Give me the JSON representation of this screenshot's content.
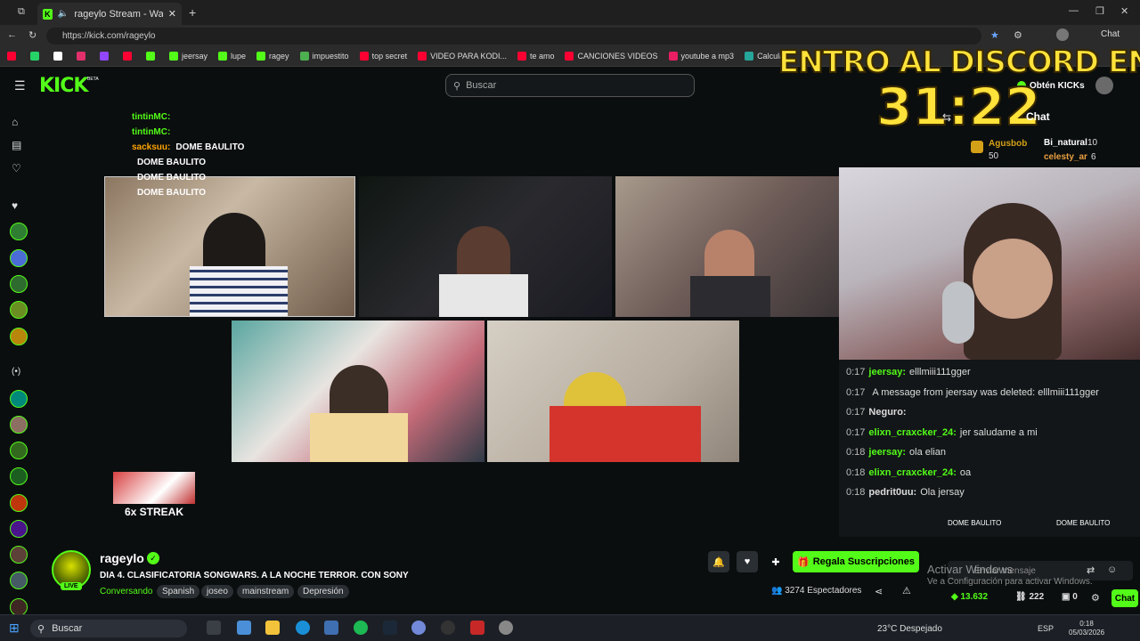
{
  "browser": {
    "tab_title": "rageylo Stream - Watch Live o",
    "url": "https://kick.com/rageylo",
    "profile_label": "Chat",
    "bookmarks": [
      {
        "label": "",
        "color": "#ff0033"
      },
      {
        "label": "",
        "color": "#25d366"
      },
      {
        "label": "",
        "color": "#ffffff"
      },
      {
        "label": "",
        "color": "#e1306c"
      },
      {
        "label": "",
        "color": "#9146ff"
      },
      {
        "label": "",
        "color": "#ff0033"
      },
      {
        "label": "",
        "color": "#53fc18"
      },
      {
        "label": "jeersay",
        "color": "#53fc18"
      },
      {
        "label": "lupe",
        "color": "#53fc18"
      },
      {
        "label": "ragey",
        "color": "#53fc18"
      },
      {
        "label": "impuestito",
        "color": "#4caf50"
      },
      {
        "label": "top secret",
        "color": "#ff0033"
      },
      {
        "label": "VIDEO PARA KODI...",
        "color": "#ff0033"
      },
      {
        "label": "te amo",
        "color": "#ff0033"
      },
      {
        "label": "CANCIONES VIDEOS",
        "color": "#ff0033"
      },
      {
        "label": "youtube a mp3",
        "color": "#e91e63"
      },
      {
        "label": "Calculad",
        "color": "#26a69a"
      }
    ]
  },
  "overlay": {
    "line1": "ENTRO AL DISCORD EN",
    "line2": "31:22"
  },
  "header": {
    "logo": "KICK",
    "beta": "BETA",
    "search_placeholder": "Buscar",
    "get_kicks": "Obtén KICKs"
  },
  "sidebar": {
    "avatar_colors": [
      "#2e7d32",
      "#4a6cd4",
      "#2e6b2e",
      "#6b8e23",
      "#b8860b",
      "#00897b",
      "#8d6e63",
      "#33691e",
      "#1b5e20",
      "#bf360c",
      "#4a148c",
      "#5d4037",
      "#455a64",
      "#3e2723"
    ]
  },
  "stream": {
    "chat_overlay": [
      {
        "user": "tintinMC:",
        "color": "#53fc18",
        "msg": ""
      },
      {
        "user": "tintinMC:",
        "color": "#53fc18",
        "msg": ""
      },
      {
        "user": "sacksuu:",
        "color": "#ffa500",
        "msg": "DOME BAULITO"
      },
      {
        "user": "",
        "color": "#fff",
        "msg": "DOME BAULITO"
      },
      {
        "user": "",
        "color": "#fff",
        "msg": "DOME BAULITO"
      },
      {
        "user": "",
        "color": "#fff",
        "msg": "DOME BAULITO"
      }
    ],
    "streak": "6x STREAK",
    "top_gifters": [
      {
        "name": "Agusbob",
        "amount": "50"
      },
      {
        "name": "Bi_natural",
        "amount": "10"
      },
      {
        "name": "celesty_ar",
        "amount": "6"
      }
    ]
  },
  "chat": {
    "title": "Chat",
    "messages": [
      {
        "time": "0:17",
        "user": "jeersay:",
        "color": "#53fc18",
        "text": "elllmiii111gger"
      },
      {
        "time": "0:17",
        "user": "",
        "color": "#ddd",
        "text": "A message from jeersay was deleted: elllmiii111gger"
      },
      {
        "time": "0:17",
        "user": "Neguro:",
        "color": "#ddd",
        "text": ""
      },
      {
        "time": "0:17",
        "user": "elixn_craxcker_24:",
        "color": "#53fc18",
        "text": "jer saludame a mi"
      },
      {
        "time": "0:18",
        "user": "jeersay:",
        "color": "#53fc18",
        "text": "ola elian"
      },
      {
        "time": "0:18",
        "user": "elixn_craxcker_24:",
        "color": "#53fc18",
        "text": "oa"
      },
      {
        "time": "0:18",
        "user": "pedrit0uu:",
        "color": "#ddd",
        "text": "Ola jersay"
      }
    ],
    "input_placeholder": "Enviar mensaje",
    "chat_button": "Chat",
    "kicks_count": "13.632",
    "points": "222",
    "zero": "0",
    "dome_label_1": "DOME BAULITO",
    "dome_label_2": "DOME BAULITO"
  },
  "channel": {
    "name": "rageylo",
    "live_badge": "LIVE",
    "title": "DIA 4. CLASIFICATORIA SONGWARS. A LA NOCHE TERROR. CON SONY",
    "category": "Conversando",
    "tags": [
      "Spanish",
      "joseo",
      "mainstream",
      "Depresión"
    ],
    "subscribe_label": "Regala Suscripciones",
    "viewers": "3274 Espectadores"
  },
  "windows": {
    "activate_title": "Activar Windows",
    "activate_sub": "Ve a Configuración para activar Windows.",
    "search": "Buscar",
    "weather": "23°C  Despejado",
    "lang": "ESP",
    "time": "0:18",
    "date": "05/03/2026"
  },
  "colors": {
    "accent": "#53fc18",
    "overlay_yellow": "#ffe23a",
    "bg": "#0b0e0f"
  }
}
